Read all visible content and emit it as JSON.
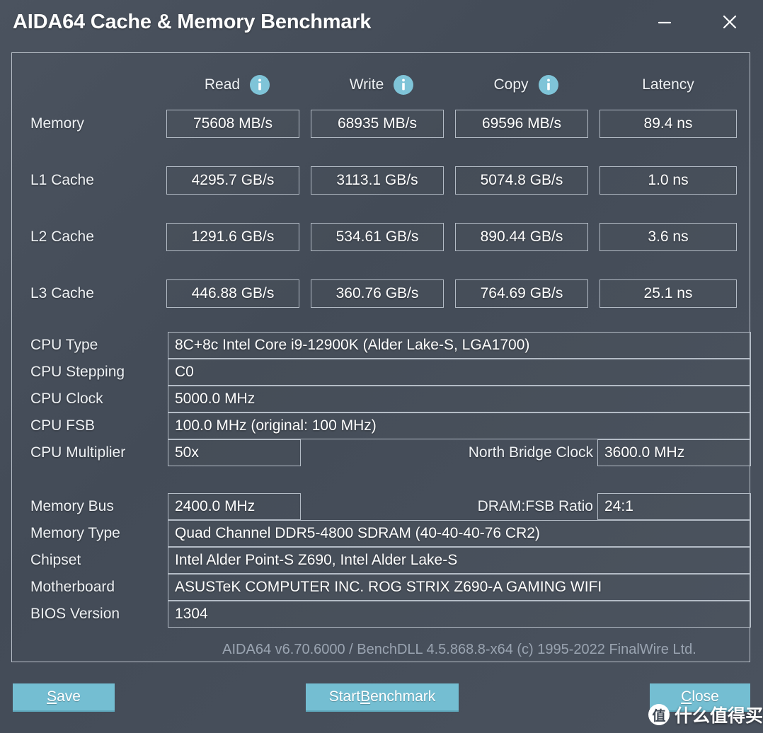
{
  "window": {
    "title": "AIDA64 Cache & Memory Benchmark",
    "minimize_icon": "minimize-icon",
    "close_icon": "close-icon"
  },
  "benchmark": {
    "columns": [
      {
        "label": "Read",
        "has_info": true,
        "info_icon": "info-icon"
      },
      {
        "label": "Write",
        "has_info": true,
        "info_icon": "info-icon"
      },
      {
        "label": "Copy",
        "has_info": true,
        "info_icon": "info-icon"
      },
      {
        "label": "Latency",
        "has_info": false
      }
    ],
    "rows": [
      {
        "label": "Memory",
        "read": "75608 MB/s",
        "write": "68935 MB/s",
        "copy": "69596 MB/s",
        "latency": "89.4 ns"
      },
      {
        "label": "L1 Cache",
        "read": "4295.7 GB/s",
        "write": "3113.1 GB/s",
        "copy": "5074.8 GB/s",
        "latency": "1.0 ns"
      },
      {
        "label": "L2 Cache",
        "read": "1291.6 GB/s",
        "write": "534.61 GB/s",
        "copy": "890.44 GB/s",
        "latency": "3.6 ns"
      },
      {
        "label": "L3 Cache",
        "read": "446.88 GB/s",
        "write": "360.76 GB/s",
        "copy": "764.69 GB/s",
        "latency": "25.1 ns"
      }
    ]
  },
  "cpu_info": {
    "type_label": "CPU Type",
    "type_value": "8C+8c Intel Core i9-12900K  (Alder Lake-S, LGA1700)",
    "stepping_label": "CPU Stepping",
    "stepping_value": "C0",
    "clock_label": "CPU Clock",
    "clock_value": "5000.0 MHz",
    "fsb_label": "CPU FSB",
    "fsb_value": "100.0 MHz  (original: 100 MHz)",
    "multiplier_label": "CPU Multiplier",
    "multiplier_value": "50x",
    "north_bridge_label": "North Bridge Clock",
    "north_bridge_value": "3600.0 MHz"
  },
  "system_info": {
    "membus_label": "Memory Bus",
    "membus_value": "2400.0 MHz",
    "dram_ratio_label": "DRAM:FSB Ratio",
    "dram_ratio_value": "24:1",
    "memtype_label": "Memory Type",
    "memtype_value": "Quad Channel DDR5-4800 SDRAM  (40-40-40-76 CR2)",
    "chipset_label": "Chipset",
    "chipset_value": "Intel Alder Point-S Z690, Intel Alder Lake-S",
    "motherboard_label": "Motherboard",
    "motherboard_value": "ASUSTeK COMPUTER INC. ROG STRIX Z690-A GAMING WIFI",
    "bios_label": "BIOS Version",
    "bios_value": "1304"
  },
  "footer": {
    "version_note": "AIDA64 v6.70.6000 / BenchDLL 4.5.868.8-x64  (c) 1995-2022 FinalWire Ltd."
  },
  "buttons": {
    "save": {
      "prefix": "",
      "accel": "S",
      "suffix": "ave"
    },
    "start": {
      "prefix": "Start ",
      "accel": "B",
      "suffix": "enchmark"
    },
    "close": {
      "prefix": "",
      "accel": "C",
      "suffix": "lose"
    }
  },
  "watermark": {
    "badge": "值",
    "text": "什么值得买"
  },
  "colors": {
    "window_bg": "#454d59",
    "accent_button": "#74bed2",
    "info_icon": "#7fc4d8",
    "border": "#b4bcc6",
    "text": "#ffffff",
    "muted_text": "#9aa4b1"
  }
}
